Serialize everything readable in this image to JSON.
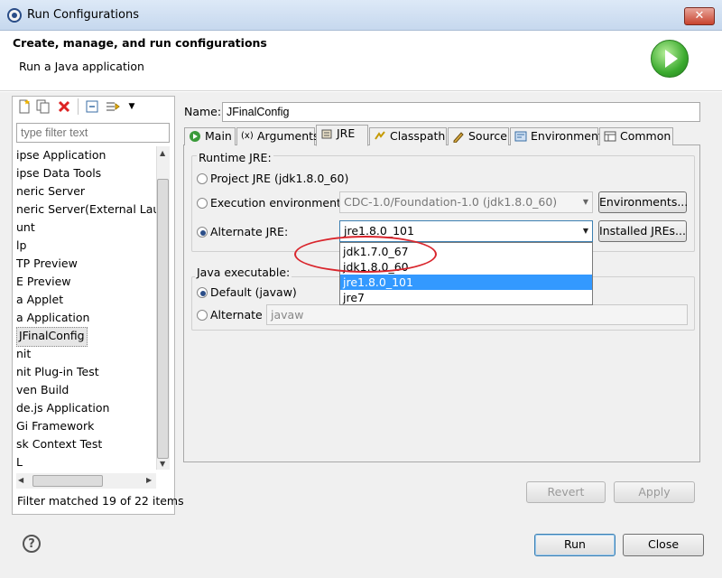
{
  "window": {
    "title": "Run Configurations",
    "close_glyph": "✕"
  },
  "header": {
    "title": "Create, manage, and run configurations",
    "subtitle": "Run a Java application",
    "badge_icon": "run-play-icon"
  },
  "toolbar": {
    "icons": [
      "new-config-icon",
      "duplicate-icon",
      "delete-icon",
      "collapse-all-icon",
      "filter-icon",
      "view-menu-icon"
    ]
  },
  "filter": {
    "placeholder": "type filter text",
    "status": "Filter matched 19 of 22 items"
  },
  "config_types": [
    "ipse Application",
    "ipse Data Tools",
    "neric Server",
    "neric Server(External Launc",
    "unt",
    "lp",
    "TP Preview",
    "E Preview",
    "a Applet",
    "a Application",
    "JFinalConfig",
    "nit",
    "nit Plug-in Test",
    "ven Build",
    "de.js Application",
    "Gi Framework",
    "sk Context Test",
    "L"
  ],
  "selected_index": 10,
  "name": {
    "label": "Name:",
    "value": "JFinalConfig"
  },
  "tabs": [
    {
      "label": "Main",
      "icon": "main-tab-icon"
    },
    {
      "label": "Arguments",
      "icon": "arguments-tab-icon"
    },
    {
      "label": "JRE",
      "icon": "jre-tab-icon"
    },
    {
      "label": "Classpath",
      "icon": "classpath-tab-icon"
    },
    {
      "label": "Source",
      "icon": "source-tab-icon"
    },
    {
      "label": "Environment",
      "icon": "environment-tab-icon"
    },
    {
      "label": "Common",
      "icon": "common-tab-icon"
    }
  ],
  "active_tab": "JRE",
  "runtime": {
    "group_label": "Runtime JRE:",
    "project_jre": "Project JRE (jdk1.8.0_60)",
    "exec_env_label": "Execution environment:",
    "exec_env_value": "CDC-1.0/Foundation-1.0 (jdk1.8.0_60)",
    "environments_button": "Environments...",
    "alt_jre_label": "Alternate JRE:",
    "alt_jre_value": "jre1.8.0_101",
    "installed_jres_button": "Installed JREs...",
    "selected_option": "Alternate JRE:"
  },
  "dropdown": {
    "options": [
      "jdk1.7.0_67",
      "jdk1.8.0_60",
      "jre1.8.0_101",
      "jre7"
    ],
    "highlighted": "jre1.8.0_101"
  },
  "executable": {
    "group_label": "Java executable:",
    "default_label": "Default (javaw)",
    "alternate_label": "Alternate",
    "alternate_value": "javaw",
    "selected_option": "Default (javaw)"
  },
  "buttons": {
    "revert": "Revert",
    "apply": "Apply",
    "run": "Run",
    "close": "Close"
  },
  "colors": {
    "accent": "#3399ff",
    "annotation": "#d9262d",
    "run_badge": "#3cab2f"
  }
}
